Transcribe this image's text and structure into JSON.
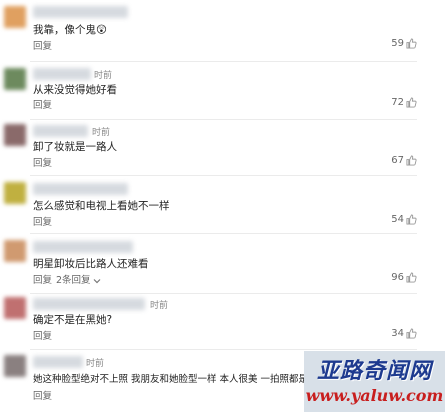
{
  "comments": [
    {
      "time": "",
      "text": "我靠，像个鬼😲",
      "reply": "回复",
      "sub_replies": "",
      "likes": "59",
      "avatar_color": "#e0a060"
    },
    {
      "time": "时前",
      "text": "从来没觉得她好看",
      "reply": "回复",
      "sub_replies": "",
      "likes": "72",
      "avatar_color": "#6d8a5e"
    },
    {
      "time": "时前",
      "text": "卸了妆就是一路人",
      "reply": "回复",
      "sub_replies": "",
      "likes": "67",
      "avatar_color": "#8a6a6a"
    },
    {
      "time": "",
      "text": "怎么感觉和电视上看她不一样",
      "reply": "回复",
      "sub_replies": "",
      "likes": "54",
      "avatar_color": "#c0b040"
    },
    {
      "time": "",
      "text": "明星卸妆后比路人还难看",
      "reply": "回复",
      "sub_replies": "2条回复",
      "likes": "96",
      "avatar_color": "#d09a70"
    },
    {
      "time": "时前",
      "text": "确定不是在黑她?",
      "reply": "回复",
      "sub_replies": "",
      "likes": "34",
      "avatar_color": "#c07070"
    },
    {
      "time": "时前",
      "text": "她这种脸型绝对不上照 我朋友和她脸型一样 本人很美 一拍照都是",
      "reply": "回复",
      "sub_replies": "",
      "likes": "",
      "avatar_color": "#8a8080"
    }
  ],
  "watermark": {
    "title": "亚路奇闻网",
    "url": "www.yaluw.com"
  },
  "colors": {
    "like_icon": "#999999",
    "divider": "#ebebeb",
    "watermark_title": "#1d3a8f",
    "watermark_url": "#c81e1e"
  },
  "icons": {
    "like": "thumbs-up-icon",
    "reply_dropdown": "chevron-down-icon"
  }
}
